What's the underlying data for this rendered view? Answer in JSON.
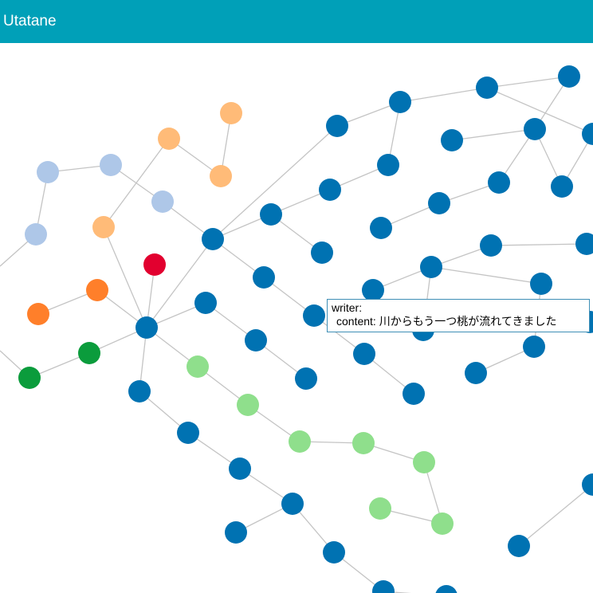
{
  "app": {
    "title": "Utatane",
    "header_color": "#00a0b8"
  },
  "tooltip": {
    "writer_label": "writer:",
    "content_label": "content:",
    "content_value": "川からもう一つ桃が流れてきました"
  },
  "colors": {
    "default": "#0072b2",
    "light_blue": "#aec7e8",
    "light_orange": "#ffbb78",
    "orange": "#ff7f2a",
    "red": "#e2002f",
    "green": "#0b9c3c",
    "light_green": "#8fdf8c"
  }
}
